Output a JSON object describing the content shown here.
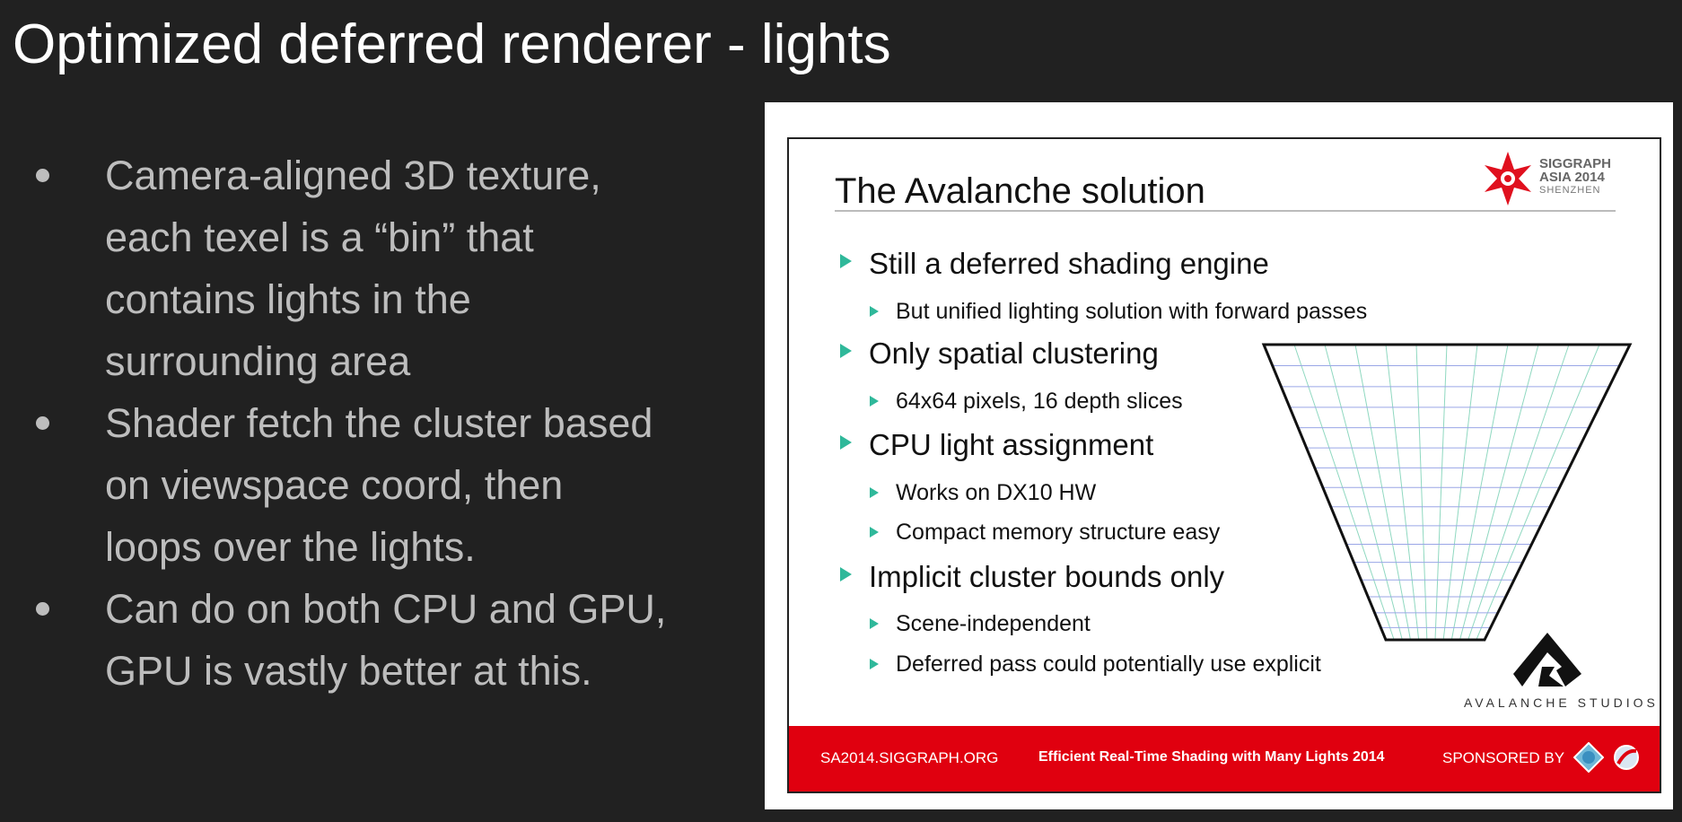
{
  "title": "Optimized deferred renderer - lights",
  "bullets": [
    {
      "lines": [
        "Camera-aligned 3D texture,",
        "each texel is a “bin” that",
        "contains lights in the",
        "surrounding area"
      ]
    },
    {
      "lines": [
        "Shader fetch the cluster based",
        "on viewspace coord, then",
        "loops over the lights."
      ]
    },
    {
      "lines": [
        "Can do on both CPU and GPU,",
        "GPU is vastly better at this."
      ]
    }
  ],
  "slide": {
    "title": "The Avalanche solution",
    "logo": {
      "line1": "SIGGRAPH",
      "line2": "ASIA 2014",
      "line3": "SHENZHEN"
    },
    "items": [
      {
        "text": "Still a deferred shading engine",
        "sub": [
          "But unified lighting solution with forward passes"
        ]
      },
      {
        "text": "Only spatial clustering",
        "sub": [
          "64x64 pixels, 16 depth slices"
        ]
      },
      {
        "text": "CPU light assignment",
        "sub": [
          "Works on DX10 HW",
          "Compact memory structure easy"
        ]
      },
      {
        "text": "Implicit cluster bounds only",
        "sub": [
          "Scene-independent",
          "Deferred pass could potentially use explicit"
        ]
      }
    ],
    "studio": "AVALANCHE STUDIOS",
    "footer": {
      "site": "SA2014.SIGGRAPH.ORG",
      "course": "Efficient Real-Time Shading with Many Lights 2014",
      "sponsored": "SPONSORED BY"
    },
    "accent": "#2fb89a",
    "footer_color": "#e0000f"
  }
}
